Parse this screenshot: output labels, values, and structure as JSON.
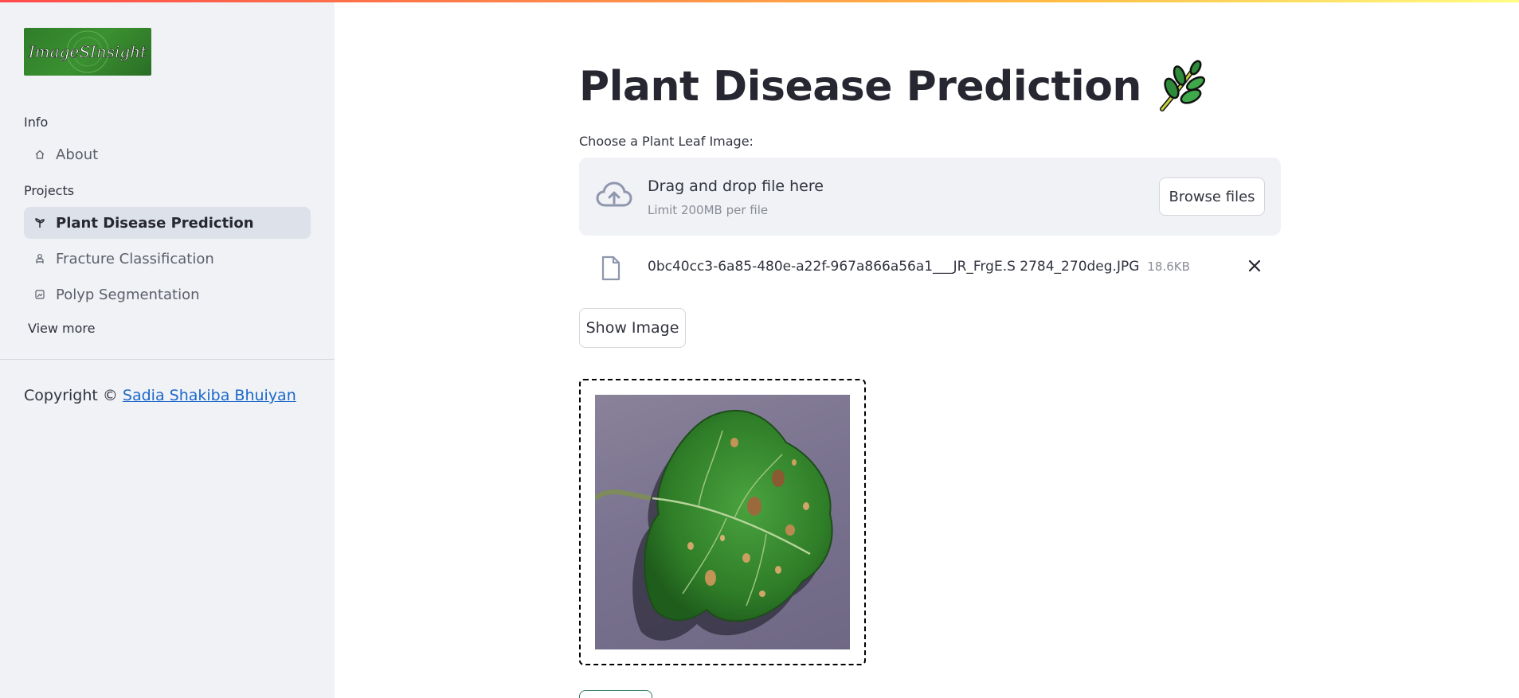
{
  "sidebar": {
    "logo_text": "ImageSInsight",
    "sections": [
      {
        "heading": "Info",
        "items": [
          {
            "label": "About",
            "icon": "home-icon",
            "active": false
          }
        ]
      },
      {
        "heading": "Projects",
        "items": [
          {
            "label": "Plant Disease Prediction",
            "icon": "plant-icon",
            "active": true
          },
          {
            "label": "Fracture Classification",
            "icon": "person-icon",
            "active": false
          },
          {
            "label": "Polyp Segmentation",
            "icon": "image-icon",
            "active": false
          }
        ]
      }
    ],
    "view_more": "View more",
    "copyright_prefix": "Copyright © ",
    "copyright_author": "Sadia Shakiba Bhuiyan"
  },
  "main": {
    "title": "Plant Disease Prediction",
    "title_icon": "leaf-icon",
    "uploader": {
      "label": "Choose a Plant Leaf Image:",
      "drop_title": "Drag and drop file here",
      "limit": "Limit 200MB per file",
      "browse_label": "Browse files"
    },
    "file": {
      "name": "0bc40cc3-6a85-480e-a22f-967a866a56a1___JR_FrgE.S 2784_270deg.JPG",
      "size": "18.6KB"
    },
    "show_image_label": "Show Image"
  },
  "colors": {
    "sidebar_bg": "#f0f2f6",
    "active_item_bg": "#dde1ea",
    "link": "#1a68c9",
    "accent_gradient": [
      "#ff4b4b",
      "#ffbd45",
      "#fffd80"
    ]
  }
}
